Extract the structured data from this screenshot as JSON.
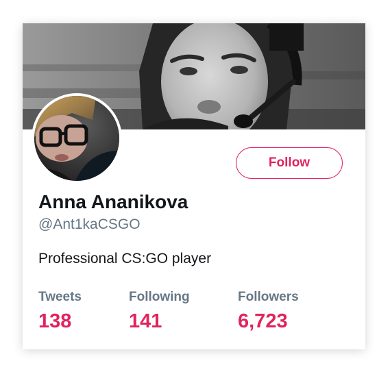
{
  "profile": {
    "name": "Anna Ananikova",
    "handle": "@Ant1kaCSGO",
    "bio": "Professional CS:GO player",
    "follow_label": "Follow",
    "banner_image": "grayscale photo of player with headset",
    "avatar_image": "portrait with glasses"
  },
  "stats": {
    "tweets_label": "Tweets",
    "tweets_value": "138",
    "following_label": "Following",
    "following_value": "141",
    "followers_label": "Followers",
    "followers_value": "6,723"
  },
  "colors": {
    "accent": "#e0245e",
    "secondary_text": "#657786",
    "primary_text": "#14171a"
  }
}
